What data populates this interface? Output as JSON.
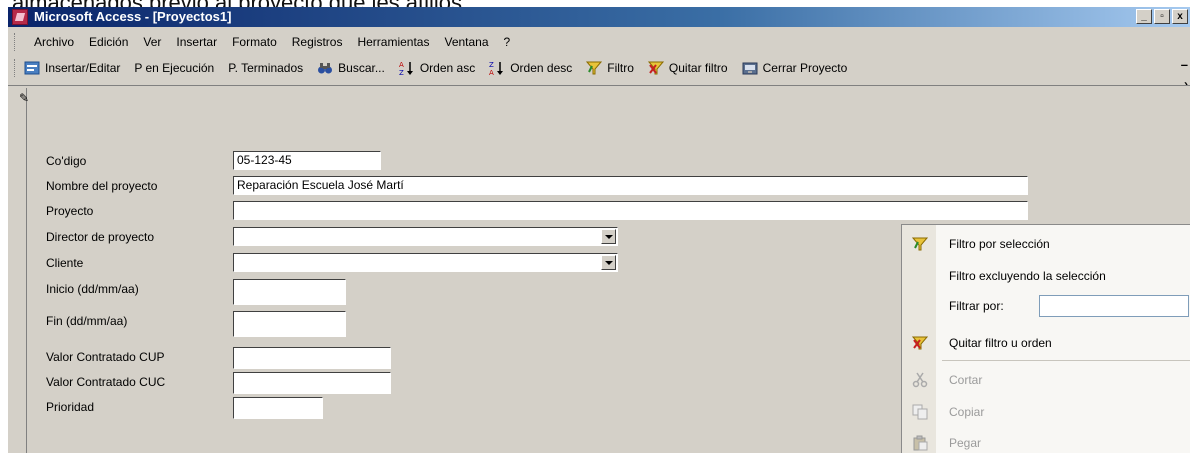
{
  "caption": "almacenados previo al proyecto que les atilios.",
  "window": {
    "title": "Microsoft Access - [Proyectos1]",
    "buttons": [
      "_",
      "▫",
      "x"
    ]
  },
  "menu": [
    "Archivo",
    "Edición",
    "Ver",
    "Insertar",
    "Formato",
    "Registros",
    "Herramientas",
    "Ventana",
    "?"
  ],
  "toolbar": {
    "insert_edit": "Insertar/Editar",
    "in_progress": "P en Ejecución",
    "finished": "P. Terminados",
    "search": "Buscar...",
    "sort_asc": "Orden asc",
    "sort_desc": "Orden desc",
    "filter": "Filtro",
    "remove_filter": "Quitar filtro",
    "close_project": "Cerrar Proyecto",
    "overflow_1": "–",
    "overflow_2": "›"
  },
  "form": {
    "codigo_label": "Co'digo",
    "codigo_value": "05-123-45",
    "nombre_label": "Nombre del proyecto",
    "nombre_value": "Reparación Escuela José Martí",
    "proyecto_label": "Proyecto",
    "proyecto_value": "",
    "director_label": "Director de proyecto",
    "director_value": "",
    "cliente_label": "Cliente",
    "cliente_value": "",
    "inicio_label": "Inicio (dd/mm/aa)",
    "inicio_value": "",
    "fin_label": "Fin (dd/mm/aa)",
    "fin_value": "",
    "cup_label": "Valor Contratado CUP",
    "cup_value": "",
    "cuc_label": "Valor Contratado CUC",
    "cuc_value": "",
    "prioridad_label": "Prioridad",
    "prioridad_value": ""
  },
  "context_menu": {
    "filter_selection": "Filtro por selección",
    "filter_excluding": "Filtro excluyendo la selección",
    "filter_by": "Filtrar por:",
    "filter_by_value": "",
    "remove_filter_sort": "Quitar filtro u orden",
    "cut": "Cortar",
    "copy": "Copiar",
    "paste": "Pegar"
  }
}
